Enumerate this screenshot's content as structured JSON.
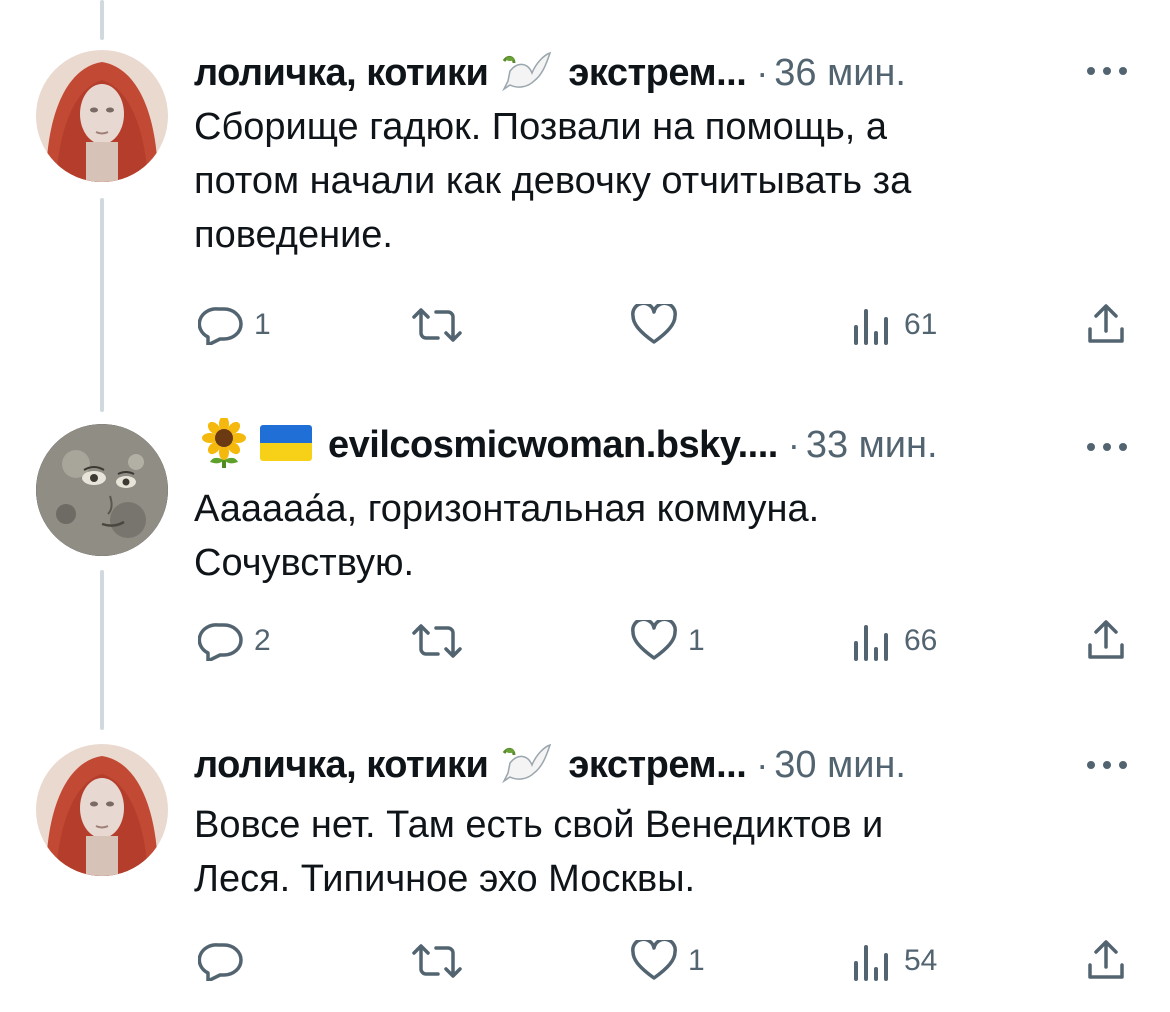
{
  "tweets": [
    {
      "author": "лоличка, котики",
      "handle_tail": "экстрем...",
      "separator": "·",
      "time": "36 мин.",
      "text_lines": [
        "Сборище гадюк. Позвали на помощь, а",
        "потом начали как девочку отчитывать за",
        "поведение."
      ],
      "replies": "1",
      "retweets": "",
      "likes": "",
      "views": "61",
      "author_emoji": [
        "dove-icon"
      ]
    },
    {
      "author": "evilcosmicwoman.bsky....",
      "separator": "·",
      "time": "33 мин.",
      "text_lines": [
        "Аааааа́а, горизонтальная коммуна.",
        "Сочувствую."
      ],
      "replies": "2",
      "retweets": "",
      "likes": "1",
      "views": "66",
      "author_emoji": [
        "sunflower-icon",
        "ukraine-flag-icon"
      ]
    },
    {
      "author": "лоличка, котики",
      "handle_tail": "экстрем...",
      "separator": "·",
      "time": "30 мин.",
      "text_lines": [
        "Вовсе нет. Там есть свой Венедиктов и",
        "Леся. Типичное эхо Москвы."
      ],
      "replies": "",
      "retweets": "",
      "likes": "1",
      "views": "54",
      "author_emoji": [
        "dove-icon"
      ]
    }
  ],
  "colors": {
    "text": "#0f1419",
    "secondary": "#536471",
    "thread_line": "#cfd9de",
    "avatar_hood": "#c24a34"
  }
}
